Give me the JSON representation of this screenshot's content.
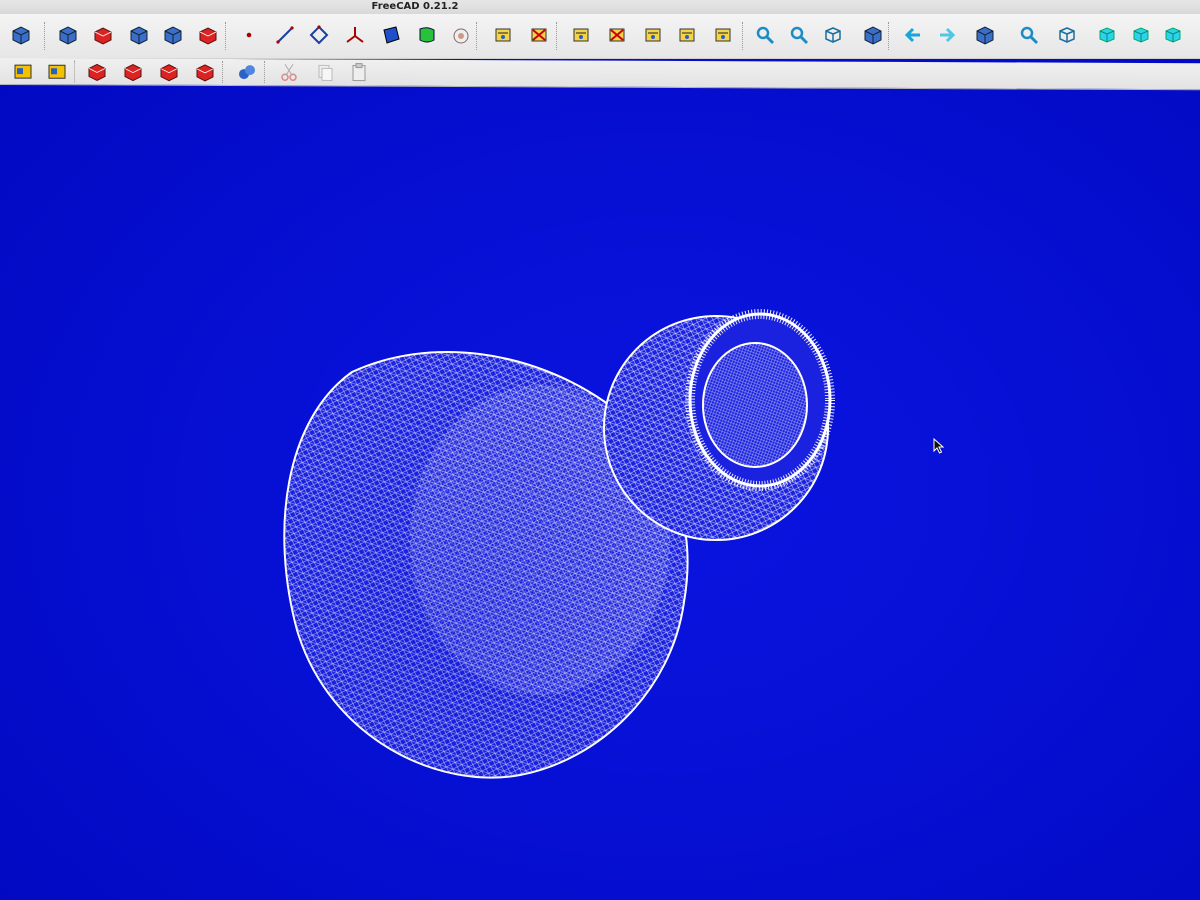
{
  "window": {
    "title": "FreeCAD 0.21.2"
  },
  "colors": {
    "viewport_bg": "#0610d4",
    "mesh": "#ffffff",
    "toolbar_bg": "#eaeaea"
  },
  "toolbar_row_1": [
    "workbench-switch-icon",
    "new-part-icon",
    "part-shape-icon",
    "import-icon",
    "export-icon",
    "check-geometry-icon",
    "point-icon",
    "line-icon",
    "polygon-icon",
    "axis-icon",
    "face-icon",
    "free-surface-icon",
    "sheep-icon",
    "measure-distance-icon",
    "measure-angle-icon",
    "measure-refresh-icon",
    "measure-clear-icon",
    "measure-toggle-icon",
    "measure-3d-icon",
    "measure-delta-icon",
    "fit-all-icon",
    "fit-selection-icon",
    "std-views-icon",
    "draw-style-icon",
    "back-icon",
    "forward-icon",
    "workbench-nav-icon",
    "zoom-dropdown-icon",
    "view-axonometric-icon",
    "view-front-icon",
    "view-top-icon",
    "view-right-icon"
  ],
  "toolbar_row_2": [
    "boolean-union-icon",
    "boolean-cut-icon",
    "fillet-icon",
    "chamfer-icon",
    "mirror-icon",
    "thickness-icon",
    "link-icon",
    "cut-icon",
    "copy-icon",
    "paste-icon"
  ]
}
